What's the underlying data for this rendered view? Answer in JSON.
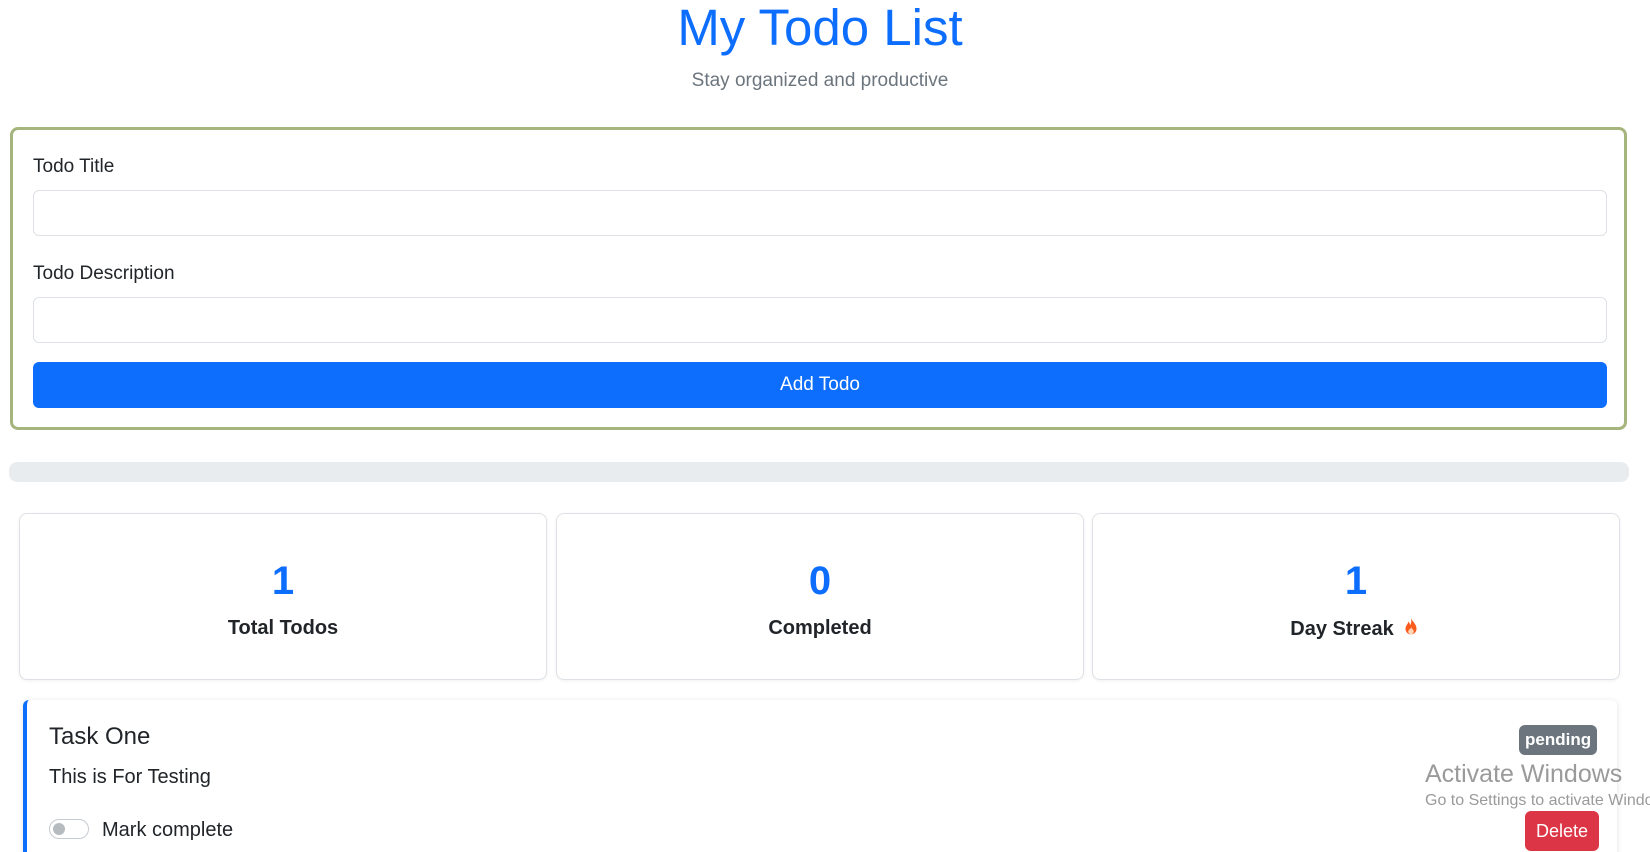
{
  "header": {
    "title": "My Todo List",
    "subtitle": "Stay organized and productive"
  },
  "form": {
    "title_label": "Todo Title",
    "title_value": "",
    "description_label": "Todo Description",
    "description_value": "",
    "add_button_label": "Add Todo"
  },
  "progress": {
    "completed_fraction": 0
  },
  "stats": {
    "total": {
      "value": "1",
      "label": "Total Todos"
    },
    "completed": {
      "value": "0",
      "label": "Completed"
    },
    "streak": {
      "value": "1",
      "label": "Day Streak",
      "icon": "fire-icon"
    }
  },
  "todos": [
    {
      "title": "Task One",
      "description": "This is For Testing",
      "status": "pending",
      "toggle_label": "Mark complete",
      "completed": false,
      "delete_label": "Delete"
    }
  ],
  "watermark": {
    "title": "Activate Windows",
    "subtitle": "Go to Settings to activate Windows."
  },
  "colors": {
    "primary": "#0d6efd",
    "danger": "#dc3545",
    "badge": "#6c757d",
    "form_border": "#a5b57d",
    "fire": "#fd5a1e"
  }
}
